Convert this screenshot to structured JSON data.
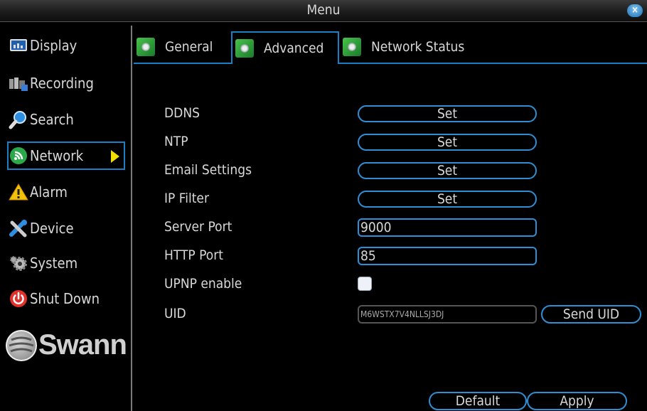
{
  "window": {
    "title": "Menu",
    "close_label": "×"
  },
  "sidebar": {
    "items": [
      {
        "label": "Display",
        "icon": "display-icon"
      },
      {
        "label": "Recording",
        "icon": "recording-icon"
      },
      {
        "label": "Search",
        "icon": "search-icon"
      },
      {
        "label": "Network",
        "icon": "network-icon",
        "active": true
      },
      {
        "label": "Alarm",
        "icon": "alarm-icon"
      },
      {
        "label": "Device",
        "icon": "device-icon"
      },
      {
        "label": "System",
        "icon": "system-icon"
      },
      {
        "label": "Shut Down",
        "icon": "power-icon"
      }
    ],
    "logo_text": "Swann"
  },
  "tabs": [
    {
      "label": "General"
    },
    {
      "label": "Advanced",
      "active": true
    },
    {
      "label": "Network Status"
    }
  ],
  "settings": {
    "ddns": {
      "label": "DDNS",
      "button": "Set"
    },
    "ntp": {
      "label": "NTP",
      "button": "Set"
    },
    "email": {
      "label": "Email Settings",
      "button": "Set"
    },
    "ip_filter": {
      "label": "IP Filter",
      "button": "Set"
    },
    "server_port": {
      "label": "Server Port",
      "value": "9000"
    },
    "http_port": {
      "label": "HTTP Port",
      "value": "85"
    },
    "upnp": {
      "label": "UPNP enable",
      "checked": false
    },
    "uid": {
      "label": "UID",
      "value": "M6WSTX7V4NLLSJ3DJ",
      "button": "Send UID"
    }
  },
  "footer": {
    "default_label": "Default",
    "apply_label": "Apply"
  },
  "colors": {
    "accent": "#2f8fd6",
    "arrow": "#f0e000"
  }
}
